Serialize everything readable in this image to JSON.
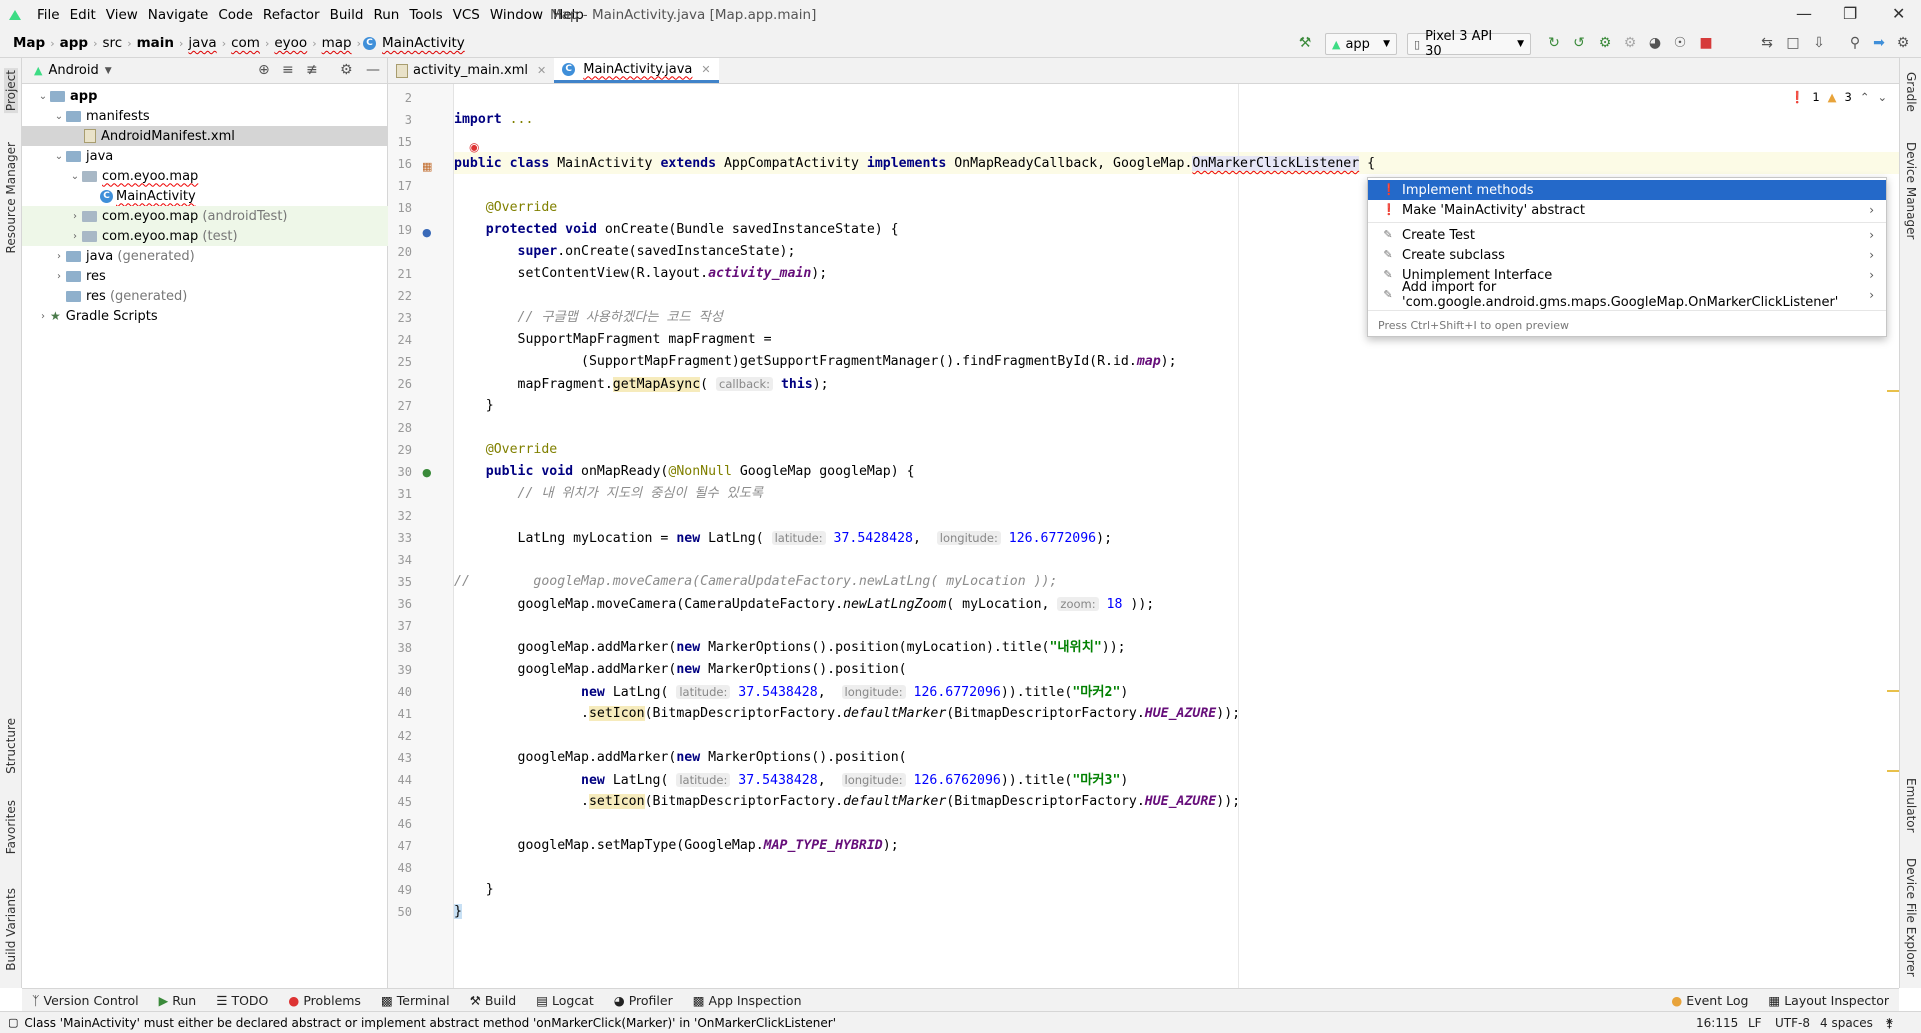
{
  "window": {
    "title": "Map - MainActivity.java [Map.app.main]",
    "menus": [
      "File",
      "Edit",
      "View",
      "Navigate",
      "Code",
      "Refactor",
      "Build",
      "Run",
      "Tools",
      "VCS",
      "Window",
      "Help"
    ]
  },
  "breadcrumb": [
    "Map",
    "app",
    "src",
    "main",
    "java",
    "com",
    "eyoo",
    "map",
    "MainActivity"
  ],
  "toolbar": {
    "run_config": "app",
    "device": "Pixel 3 API 30"
  },
  "left_strip": [
    "Project",
    "Resource Manager",
    "Structure",
    "Favorites",
    "Build Variants"
  ],
  "right_strip": [
    "Gradle",
    "Device Manager",
    "Emulator",
    "Device File Explorer"
  ],
  "project_panel": {
    "view": "Android",
    "tree": [
      {
        "label": "app",
        "suffix": ""
      },
      {
        "label": "manifests",
        "suffix": ""
      },
      {
        "label": "AndroidManifest.xml",
        "suffix": ""
      },
      {
        "label": "java",
        "suffix": ""
      },
      {
        "label": "com.eyoo.map",
        "suffix": ""
      },
      {
        "label": "MainActivity",
        "suffix": ""
      },
      {
        "label": "com.eyoo.map",
        "suffix": "(androidTest)"
      },
      {
        "label": "com.eyoo.map",
        "suffix": "(test)"
      },
      {
        "label": "java",
        "suffix": "(generated)"
      },
      {
        "label": "res",
        "suffix": ""
      },
      {
        "label": "res",
        "suffix": "(generated)"
      },
      {
        "label": "Gradle Scripts",
        "suffix": ""
      }
    ]
  },
  "tabs": [
    "activity_main.xml",
    "MainActivity.java"
  ],
  "inspections": {
    "errors": "1",
    "warnings": "3"
  },
  "line_numbers": [
    "2",
    "3",
    "15",
    "16",
    "17",
    "18",
    "19",
    "20",
    "21",
    "22",
    "23",
    "24",
    "25",
    "26",
    "27",
    "28",
    "29",
    "30",
    "31",
    "32",
    "33",
    "34",
    "35",
    "36",
    "37",
    "38",
    "39",
    "40",
    "41",
    "42",
    "43",
    "44",
    "45",
    "46",
    "47",
    "48",
    "49",
    "50"
  ],
  "code": {
    "l3_kw": "import",
    "l3_rest": " ...",
    "l16_a": "public class",
    "l16_b": " MainActivity ",
    "l16_c": "extends",
    "l16_d": " AppCompatActivity ",
    "l16_e": "implements",
    "l16_f": " OnMapReadyCallback, GoogleMap.",
    "l16_g": "OnMarkerClickListener",
    "l16_h": " {",
    "l18": "    @Override",
    "l19_a": "    protected void",
    "l19_b": " onCreate(Bundle savedInstanceState) {",
    "l20_a": "        super",
    "l20_b": ".onCreate(savedInstanceState);",
    "l21_a": "        setContentView(R.layout.",
    "l21_b": "activity_main",
    "l21_c": ");",
    "l23": "        // 구글맵 사용하겠다는 코드 작성",
    "l24": "        SupportMapFragment mapFragment =",
    "l25_a": "                (SupportMapFragment)getSupportFragmentManager().findFragmentById(R.id.",
    "l25_b": "map",
    "l25_c": ");",
    "l26_a": "        mapFragment.",
    "l26_b": "getMapAsync",
    "l26_c": "( ",
    "l26_hint": "callback:",
    "l26_d": " this",
    "l26_e": ");",
    "l27": "    }",
    "l29": "    @Override",
    "l30_a": "    public void",
    "l30_b": " onMapReady(",
    "l30_c": "@NonNull",
    "l30_d": " GoogleMap googleMap) {",
    "l31": "        // 내 위치가 지도의 중심이 될수 있도록",
    "l33_a": "        LatLng myLocation = ",
    "l33_b": "new",
    "l33_c": " LatLng( ",
    "l33_h1": "latitude:",
    "l33_n1": " 37.5428428",
    "l33_d": ",  ",
    "l33_h2": "longitude:",
    "l33_n2": " 126.6772096",
    "l33_e": ");",
    "l35": "//        googleMap.moveCamera(CameraUpdateFactory.newLatLng( myLocation ));",
    "l36_a": "        googleMap.moveCamera(CameraUpdateFactory.",
    "l36_b": "newLatLngZoom",
    "l36_c": "( myLocation, ",
    "l36_h": "zoom:",
    "l36_n": " 18",
    "l36_d": " ));",
    "l38_a": "        googleMap.addMarker(",
    "l38_b": "new",
    "l38_c": " MarkerOptions().position(myLocation).title(",
    "l38_s": "\"내위치\"",
    "l38_d": "));",
    "l39_a": "        googleMap.addMarker(",
    "l39_b": "new",
    "l39_c": " MarkerOptions().position(",
    "l40_a": "                ",
    "l40_b": "new",
    "l40_c": " LatLng( ",
    "l40_h1": "latitude:",
    "l40_n1": " 37.5438428",
    "l40_d": ",  ",
    "l40_h2": "longitude:",
    "l40_n2": " 126.6772096",
    "l40_e": ")).title(",
    "l40_s": "\"마커2\"",
    "l40_f": ")",
    "l41_a": "                .",
    "l41_b": "setIcon",
    "l41_c": "(BitmapDescriptorFactory.",
    "l41_d": "defaultMarker",
    "l41_e": "(BitmapDescriptorFactory.",
    "l41_f": "HUE_AZURE",
    "l41_g": "));",
    "l43_a": "        googleMap.addMarker(",
    "l43_b": "new",
    "l43_c": " MarkerOptions().position(",
    "l44_a": "                ",
    "l44_b": "new",
    "l44_c": " LatLng( ",
    "l44_h1": "latitude:",
    "l44_n1": " 37.5438428",
    "l44_d": ",  ",
    "l44_h2": "longitude:",
    "l44_n2": " 126.6762096",
    "l44_e": ")).title(",
    "l44_s": "\"마커3\"",
    "l44_f": ")",
    "l45_a": "                .",
    "l45_b": "setIcon",
    "l45_c": "(BitmapDescriptorFactory.",
    "l45_d": "defaultMarker",
    "l45_e": "(BitmapDescriptorFactory.",
    "l45_f": "HUE_AZURE",
    "l45_g": "));",
    "l47_a": "        googleMap.setMapType(GoogleMap.",
    "l47_b": "MAP_TYPE_HYBRID",
    "l47_c": ");",
    "l49": "    }",
    "l50": "}"
  },
  "popup": {
    "items": [
      "Implement methods",
      "Make 'MainActivity' abstract",
      "Create Test",
      "Create subclass",
      "Unimplement Interface",
      "Add import for 'com.google.android.gms.maps.GoogleMap.OnMarkerClickListener'"
    ],
    "footer": "Press Ctrl+Shift+I to open preview"
  },
  "bottom_tools": [
    "Version Control",
    "Run",
    "TODO",
    "Problems",
    "Terminal",
    "Build",
    "Logcat",
    "Profiler",
    "App Inspection"
  ],
  "bottom_right_tools": [
    "Event Log",
    "Layout Inspector"
  ],
  "status": {
    "message": "Class 'MainActivity' must either be declared abstract or implement abstract method 'onMarkerClick(Marker)' in 'OnMarkerClickListener'",
    "position": "16:115",
    "line_sep": "LF",
    "encoding": "UTF-8",
    "indent": "4 spaces"
  },
  "colors": {
    "selection": "#2469c9",
    "accent": "#4083c9",
    "error": "#e00000",
    "warning": "#e8c04a"
  }
}
